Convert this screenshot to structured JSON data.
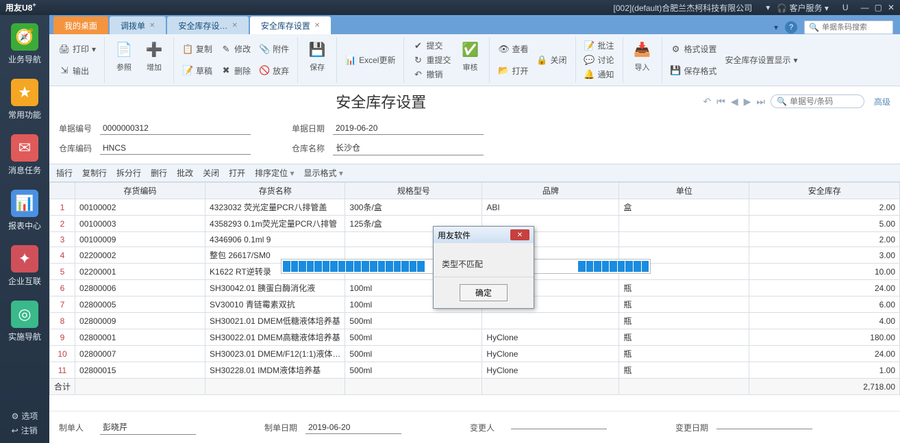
{
  "titlebar": {
    "logo": "用友",
    "product": "U8",
    "sup": "+",
    "company": "[002](default)合肥兰杰柯科技有限公司",
    "service": "客户服务",
    "u": "U"
  },
  "sidebar": {
    "items": [
      {
        "label": "业务导航",
        "icon": "🧭",
        "bg": "#3aab3a"
      },
      {
        "label": "常用功能",
        "icon": "★",
        "bg": "#f5a623"
      },
      {
        "label": "消息任务",
        "icon": "✉",
        "bg": "#e05a5a"
      },
      {
        "label": "报表中心",
        "icon": "📊",
        "bg": "#4a90e2"
      },
      {
        "label": "企业互联",
        "icon": "✦",
        "bg": "#d0505a"
      },
      {
        "label": "实施导航",
        "icon": "◎",
        "bg": "#3ab98a"
      }
    ],
    "options": "选项",
    "register": "注销"
  },
  "tabs": {
    "items": [
      {
        "label": "我的桌面"
      },
      {
        "label": "调拨单"
      },
      {
        "label": "安全库存设…"
      },
      {
        "label": "安全库存设置"
      }
    ],
    "search_ph": "单据条码搜索"
  },
  "ribbon": {
    "print": "打印",
    "output": "输出",
    "ref": "参照",
    "add": "增加",
    "copy": "复制",
    "modify": "修改",
    "attach": "附件",
    "draft": "草稿",
    "delete": "删除",
    "discard": "放弃",
    "save": "保存",
    "excel": "Excel更新",
    "submit": "提交",
    "resubmit": "重提交",
    "revoke": "撤销",
    "audit": "审核",
    "view": "查看",
    "close": "关闭",
    "open": "打开",
    "annot": "批注",
    "discuss": "讨论",
    "notify": "通知",
    "import": "导入",
    "fmt": "格式设置",
    "disp": "安全库存设置显示",
    "savefmt": "保存格式"
  },
  "page": {
    "title": "安全库存设置",
    "searchbox_ph": "单据号/条码",
    "adv": "高级",
    "doc_no_label": "单据编号",
    "doc_no": "0000000312",
    "doc_date_label": "单据日期",
    "doc_date": "2019-06-20",
    "wh_code_label": "仓库编码",
    "wh_code": "HNCS",
    "wh_name_label": "仓库名称",
    "wh_name": "长沙仓"
  },
  "toolbar2": {
    "ins": "插行",
    "dup": "复制行",
    "split": "拆分行",
    "del": "删行",
    "batch": "批改",
    "close": "关闭",
    "open": "打开",
    "sort": "排序定位",
    "dispfmt": "显示格式"
  },
  "grid": {
    "cols": [
      "存货编码",
      "存货名称",
      "规格型号",
      "品牌",
      "单位",
      "安全库存"
    ],
    "rows": [
      {
        "n": 1,
        "code": "00100002",
        "name": "4323032 荧光定量PCR八排管盖",
        "spec": "300条/盒",
        "brand": "ABI",
        "unit": "盒",
        "qty": "2.00"
      },
      {
        "n": 2,
        "code": "00100003",
        "name": "4358293 0.1m荧光定量PCR八排管",
        "spec": "125条/盒",
        "brand": "",
        "unit": "",
        "qty": "5.00"
      },
      {
        "n": 3,
        "code": "00100009",
        "name": "4346906 0.1ml 9",
        "spec": "",
        "brand": "",
        "unit": "",
        "qty": "2.00"
      },
      {
        "n": 4,
        "code": "02200002",
        "name": "整包 26617/SM0",
        "spec": "",
        "brand": "",
        "unit": "",
        "qty": "3.00"
      },
      {
        "n": 5,
        "code": "02200001",
        "name": "K1622 RT逆转录",
        "spec": "",
        "brand": "",
        "unit": "",
        "qty": "10.00"
      },
      {
        "n": 6,
        "code": "02800006",
        "name": "SH30042.01 胰蛋白酶消化液",
        "spec": "100ml",
        "brand": "",
        "unit": "瓶",
        "qty": "24.00"
      },
      {
        "n": 7,
        "code": "02800005",
        "name": "SV30010 青链霉素双抗",
        "spec": "100ml",
        "brand": "",
        "unit": "瓶",
        "qty": "6.00"
      },
      {
        "n": 8,
        "code": "02800009",
        "name": "SH30021.01 DMEM低糖液体培养基",
        "spec": "500ml",
        "brand": "",
        "unit": "瓶",
        "qty": "4.00"
      },
      {
        "n": 9,
        "code": "02800001",
        "name": "SH30022.01 DMEM高糖液体培养基",
        "spec": "500ml",
        "brand": "HyClone",
        "unit": "瓶",
        "qty": "180.00"
      },
      {
        "n": 10,
        "code": "02800007",
        "name": "SH30023.01 DMEM/F12(1:1)液体…",
        "spec": "500ml",
        "brand": "HyClone",
        "unit": "瓶",
        "qty": "24.00"
      },
      {
        "n": 11,
        "code": "02800015",
        "name": "SH30228.01 IMDM液体培养基",
        "spec": "500ml",
        "brand": "HyClone",
        "unit": "瓶",
        "qty": "1.00"
      }
    ],
    "total_label": "合计",
    "total": "2,718.00"
  },
  "footer": {
    "maker_l": "制单人",
    "maker": "彭晓芹",
    "mdate_l": "制单日期",
    "mdate": "2019-06-20",
    "changer_l": "变更人",
    "changer": "",
    "cdate_l": "变更日期",
    "cdate": ""
  },
  "dialog": {
    "title": "用友软件",
    "msg": "类型不匹配",
    "ok": "确定"
  }
}
